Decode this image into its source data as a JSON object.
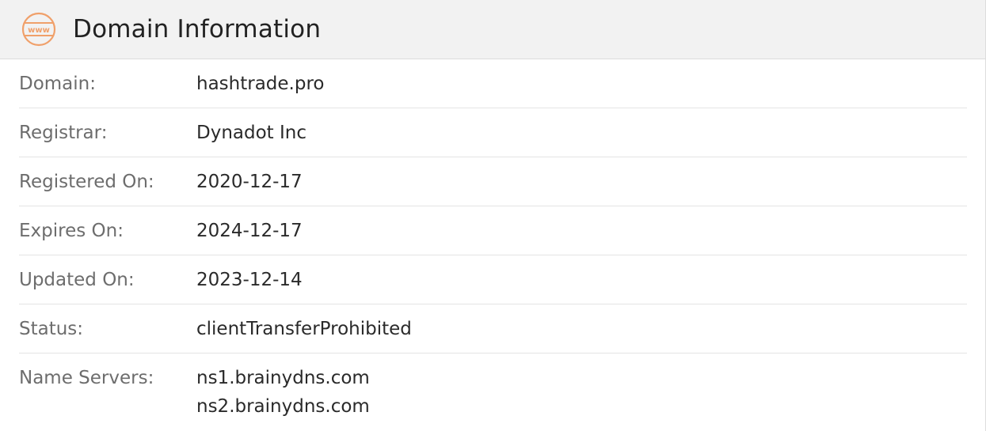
{
  "header": {
    "icon": "www-icon",
    "title": "Domain Information"
  },
  "colors": {
    "accent": "#f0a06a",
    "header_bg": "#f2f2f2",
    "label": "#6d6d6d",
    "value": "#2a2a2a"
  },
  "rows": {
    "domain": {
      "label": "Domain:",
      "value": "hashtrade.pro"
    },
    "registrar": {
      "label": "Registrar:",
      "value": "Dynadot Inc"
    },
    "registered_on": {
      "label": "Registered On:",
      "value": "2020-12-17"
    },
    "expires_on": {
      "label": "Expires On:",
      "value": "2024-12-17"
    },
    "updated_on": {
      "label": "Updated On:",
      "value": "2023-12-14"
    },
    "status": {
      "label": "Status:",
      "value": "clientTransferProhibited"
    },
    "name_servers": {
      "label": "Name Servers:",
      "values": [
        "ns1.brainydns.com",
        "ns2.brainydns.com"
      ]
    }
  }
}
